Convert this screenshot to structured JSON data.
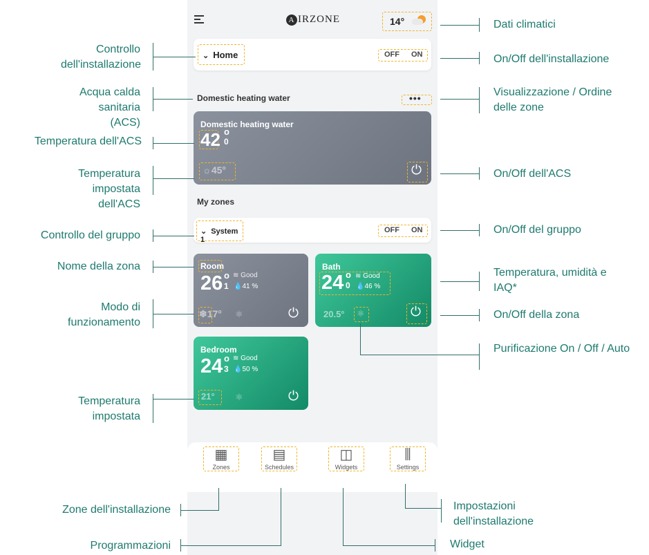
{
  "app": {
    "logo_letter": "A",
    "logo_text": "IRZONE"
  },
  "weather": {
    "temp": "14°"
  },
  "install": {
    "name": "Home",
    "off": "OFF",
    "on": "ON"
  },
  "dhw_section": {
    "title": "Domestic heating water",
    "more": "•••"
  },
  "dhw": {
    "title": "Domestic heating water",
    "temp_main": "42",
    "temp_sup": "o",
    "temp_dec": "0",
    "setpoint": "☼45°"
  },
  "myzones": {
    "title": "My zones"
  },
  "group": {
    "name": "System 1",
    "off": "OFF",
    "on": "ON"
  },
  "zones": [
    {
      "name": "Room",
      "temp_main": "26",
      "temp_dec": "1",
      "iaq": "Good",
      "hum": "41 %",
      "setpoint": "❄17°"
    },
    {
      "name": "Bath",
      "temp_main": "24",
      "temp_dec": "0",
      "iaq": "Good",
      "hum": "46 %",
      "setpoint": "20.5°"
    },
    {
      "name": "Bedroom",
      "temp_main": "24",
      "temp_dec": "3",
      "iaq": "Good",
      "hum": "50 %",
      "setpoint": "21°"
    }
  ],
  "tabs": [
    {
      "label": "Zones",
      "icon": "grid-icon"
    },
    {
      "label": "Schedules",
      "icon": "calendar-icon"
    },
    {
      "label": "Widgets",
      "icon": "widgets-icon"
    },
    {
      "label": "Settings",
      "icon": "sliders-icon"
    }
  ],
  "annotations_left": {
    "a1": "Controllo dell'installazione",
    "a2": "Acqua calda sanitaria (ACS)",
    "a3": "Temperatura dell'ACS",
    "a4": "Temperatura impostata dell'ACS",
    "a5": "Controllo del gruppo",
    "a6": "Nome della zona",
    "a7": "Modo di funzionamento",
    "a8": "Temperatura impostata",
    "a9": "Zone dell'installazione",
    "a10": "Programmazioni"
  },
  "annotations_right": {
    "b1": "Dati climatici",
    "b2": "On/Off dell'installazione",
    "b3": "Visualizzazione / Ordine delle zone",
    "b4": "On/Off dell'ACS",
    "b5": "On/Off del gruppo",
    "b6": "Temperatura, umidità e IAQ*",
    "b7": "On/Off della zona",
    "b8": "Purificazione On / Off / Auto",
    "b9": "Impostazioni dell'installazione",
    "b10": "Widget"
  }
}
